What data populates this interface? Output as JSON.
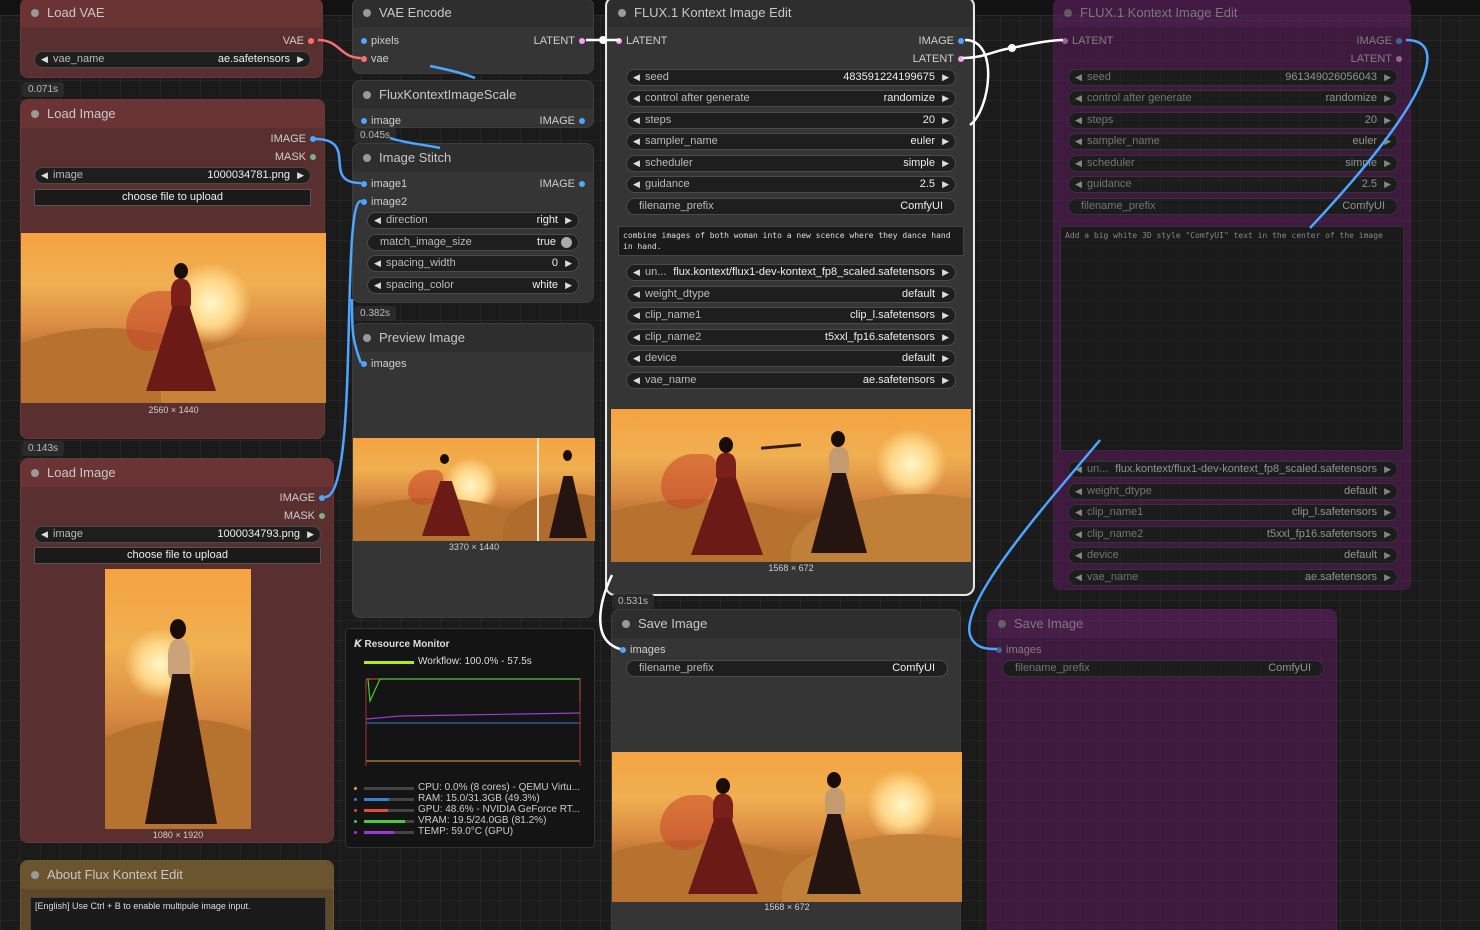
{
  "colors": {
    "image_slot": "#4da6ff",
    "latent_slot": "#ff9cf9",
    "vae_slot": "#ff6e6e",
    "brown_node": "#5a2f2f",
    "purple_node": "#5d1a5d",
    "gray_node": "#353535"
  },
  "timings": {
    "t1": "0.071s",
    "t2": "0.143s",
    "t3": "0.045s",
    "t4": "0.382s",
    "t5": "0.531s"
  },
  "load_vae": {
    "title": "Load VAE",
    "out_vae": "VAE",
    "vae_name_label": "vae_name",
    "vae_name_value": "ae.safetensors"
  },
  "load_image_1": {
    "title": "Load Image",
    "out_image": "IMAGE",
    "out_mask": "MASK",
    "image_label": "image",
    "image_value": "1000034781.png",
    "upload_button": "choose file to upload",
    "caption": "2560 × 1440"
  },
  "load_image_2": {
    "title": "Load Image",
    "out_image": "IMAGE",
    "out_mask": "MASK",
    "image_label": "image",
    "image_value": "1000034793.png",
    "upload_button": "choose file to upload",
    "caption": "1080 × 1920"
  },
  "about": {
    "title": "About Flux Kontext Edit",
    "text": "[English] Use Ctrl + B to enable multipule image input."
  },
  "vae_encode": {
    "title": "VAE Encode",
    "in_pixels": "pixels",
    "in_vae": "vae",
    "out_latent": "LATENT"
  },
  "scale": {
    "title": "FluxKontextImageScale",
    "in_image": "image",
    "out_image": "IMAGE"
  },
  "stitch": {
    "title": "Image Stitch",
    "in_image1": "image1",
    "in_image2": "image2",
    "out_image": "IMAGE",
    "widgets": [
      {
        "label": "direction",
        "value": "right"
      },
      {
        "label": "match_image_size",
        "value": "true"
      },
      {
        "label": "spacing_width",
        "value": "0"
      },
      {
        "label": "spacing_color",
        "value": "white"
      }
    ]
  },
  "preview": {
    "title": "Preview Image",
    "in_images": "images",
    "caption": "3370 × 1440"
  },
  "monitor": {
    "title": "Resource Monitor",
    "workflow": "Workflow: 100.0% - 57.5s",
    "cpu": "CPU: 0.0% (8 cores) - QEMU Virtu...",
    "ram": "RAM: 15.0/31.3GB (49.3%)",
    "gpu": "GPU: 48.6% - NVIDIA GeForce RT...",
    "vram": "VRAM: 19.5/24.0GB (81.2%)",
    "temp": "TEMP: 59.0°C (GPU)",
    "levels": {
      "cpu": 0.0,
      "ram": 0.493,
      "gpu": 0.486,
      "vram": 0.812,
      "temp": 0.59
    },
    "bar_colors": {
      "cpu": "#e8a33a",
      "ram": "#3d7dd8",
      "gpu": "#e84a3a",
      "vram": "#4ac93a",
      "temp": "#9b3ad8"
    }
  },
  "kontext": {
    "title": "FLUX.1 Kontext Image Edit",
    "in_latent": "LATENT",
    "out_image": "IMAGE",
    "out_latent": "LATENT",
    "widgets": [
      {
        "label": "seed",
        "value": "483591224199675"
      },
      {
        "label": "control after generate",
        "value": "randomize"
      },
      {
        "label": "steps",
        "value": "20"
      },
      {
        "label": "sampler_name",
        "value": "euler"
      },
      {
        "label": "scheduler",
        "value": "simple"
      },
      {
        "label": "guidance",
        "value": "2.5"
      }
    ],
    "filename_label": "filename_prefix",
    "filename_value": "ComfyUI",
    "prompt": "combine images of both woman into a new scence where they dance hand in hand.",
    "widgets2": [
      {
        "label": "un...",
        "value": "flux.kontext/flux1-dev-kontext_fp8_scaled.safetensors"
      },
      {
        "label": "weight_dtype",
        "value": "default"
      },
      {
        "label": "clip_name1",
        "value": "clip_l.safetensors"
      },
      {
        "label": "clip_name2",
        "value": "t5xxl_fp16.safetensors"
      },
      {
        "label": "device",
        "value": "default"
      },
      {
        "label": "vae_name",
        "value": "ae.safetensors"
      }
    ],
    "caption": "1568 × 672"
  },
  "kontext_ghost": {
    "title": "FLUX.1 Kontext Image Edit",
    "in_latent": "LATENT",
    "out_image": "IMAGE",
    "out_latent": "LATENT",
    "widgets": [
      {
        "label": "seed",
        "value": "961349026056043"
      },
      {
        "label": "control after generate",
        "value": "randomize"
      },
      {
        "label": "steps",
        "value": "20"
      },
      {
        "label": "sampler_name",
        "value": "euler"
      },
      {
        "label": "scheduler",
        "value": "simple"
      },
      {
        "label": "guidance",
        "value": "2.5"
      }
    ],
    "filename_label": "filename_prefix",
    "filename_value": "ComfyUI",
    "prompt": "Add a big white 3D style \"ComfyUI\" text in the center of the image",
    "widgets2": [
      {
        "label": "un...",
        "value": "flux.kontext/flux1-dev-kontext_fp8_scaled.safetensors"
      },
      {
        "label": "weight_dtype",
        "value": "default"
      },
      {
        "label": "clip_name1",
        "value": "clip_l.safetensors"
      },
      {
        "label": "clip_name2",
        "value": "t5xxl_fp16.safetensors"
      },
      {
        "label": "device",
        "value": "default"
      },
      {
        "label": "vae_name",
        "value": "ae.safetensors"
      }
    ]
  },
  "save": {
    "title": "Save Image",
    "in_images": "images",
    "filename_label": "filename_prefix",
    "filename_value": "ComfyUI",
    "caption": "1568 × 672"
  },
  "save_ghost": {
    "title": "Save Image",
    "in_images": "images",
    "filename_label": "filename_prefix",
    "filename_value": "ComfyUI"
  }
}
